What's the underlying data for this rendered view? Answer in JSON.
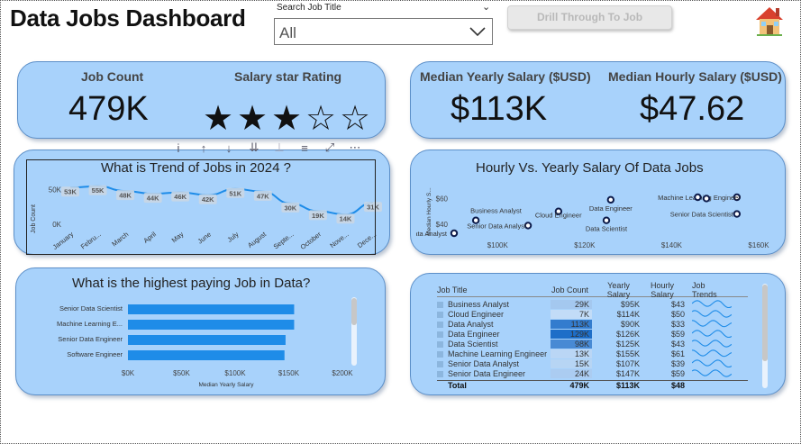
{
  "header": {
    "title": "Data Jobs Dashboard",
    "slicer_label": "Search Job Title",
    "slicer_value": "All",
    "drill_button": "Drill Through To Job"
  },
  "kpi_left": {
    "job_count_label": "Job Count",
    "job_count_value": "479K",
    "rating_label": "Salary star Rating",
    "rating_value": 3,
    "rating_max": 5
  },
  "kpi_right": {
    "median_yearly_label": "Median Yearly Salary ($USD)",
    "median_yearly_value": "$113K",
    "median_hourly_label": "Median Hourly Salary ($USD)",
    "median_hourly_value": "$47.62"
  },
  "toolbar_icons": [
    "info-icon",
    "arrow-up-icon",
    "arrow-down-icon",
    "double-arrow-down-icon",
    "pin-icon",
    "filter-icon",
    "focus-mode-icon",
    "more-options-icon"
  ],
  "chart_data": [
    {
      "type": "line",
      "title": "What is Trend of Jobs in 2024 ?",
      "ylabel": "Job Count",
      "xlabel": "",
      "y_ticks": [
        "50K",
        "0K"
      ],
      "ylim": [
        0,
        65000
      ],
      "categories": [
        "January",
        "Febru...",
        "March",
        "April",
        "May",
        "June",
        "July",
        "August",
        "Septe...",
        "October",
        "Nove...",
        "Dece..."
      ],
      "values": [
        53000,
        55000,
        48000,
        44000,
        46000,
        42000,
        51000,
        47000,
        30000,
        19000,
        14000,
        31000
      ],
      "data_labels": [
        "53K",
        "55K",
        "48K",
        "44K",
        "46K",
        "42K",
        "51K",
        "47K",
        "30K",
        "19K",
        "14K",
        "31K"
      ],
      "grid": false,
      "color": "#1e8ce8"
    },
    {
      "type": "scatter",
      "title": "Hourly Vs. Yearly Salary Of Data Jobs",
      "ylabel": "Median Hourly S...",
      "xlabel": "",
      "x_ticks": [
        "$100K",
        "$120K",
        "$140K",
        "$160K"
      ],
      "y_ticks": [
        "$60",
        "$40"
      ],
      "xlim": [
        90000,
        160000
      ],
      "ylim": [
        30000,
        70000
      ],
      "points": [
        {
          "label": "Business Analyst",
          "x": 95000,
          "y": 43
        },
        {
          "label": "Data Analyst",
          "x": 90000,
          "y": 33
        },
        {
          "label": "Cloud Engineer",
          "x": 114000,
          "y": 50
        },
        {
          "label": "Data Engineer",
          "x": 126000,
          "y": 59
        },
        {
          "label": "Data Scientist",
          "x": 125000,
          "y": 43
        },
        {
          "label": "Machine Learning Engineer",
          "x": 155000,
          "y": 61
        },
        {
          "label": "Senior Data Analyst",
          "x": 107000,
          "y": 39
        },
        {
          "label": "Senior Data Scientist",
          "x": 155000,
          "y": 48
        },
        {
          "label": "",
          "x": 148000,
          "y": 60
        },
        {
          "label": "",
          "x": 146000,
          "y": 61
        }
      ],
      "color": "#0d1b4a"
    },
    {
      "type": "bar",
      "orientation": "horizontal",
      "title": "What is the highest paying Job in Data?",
      "xlabel": "Median Yearly Salary",
      "ylabel": "",
      "categories": [
        "Senior Data Scientist",
        "Machine Learning E...",
        "Senior Data Engineer",
        "Software Engineer"
      ],
      "values": [
        155000,
        155000,
        147000,
        146000
      ],
      "x_ticks": [
        "$0K",
        "$50K",
        "$100K",
        "$150K",
        "$200K"
      ],
      "xlim": [
        0,
        200000
      ],
      "color": "#1e8ce8"
    },
    {
      "type": "table",
      "columns": [
        "Job Title",
        "Job Count",
        "Yearly Salary",
        "Hourly Salary",
        "Job Trends"
      ],
      "rows": [
        {
          "title": "Business Analyst",
          "count": "29K",
          "count_num": 29,
          "yearly": "$95K",
          "hourly": "$43"
        },
        {
          "title": "Cloud Engineer",
          "count": "7K",
          "count_num": 7,
          "yearly": "$114K",
          "hourly": "$50"
        },
        {
          "title": "Data Analyst",
          "count": "113K",
          "count_num": 113,
          "yearly": "$90K",
          "hourly": "$33"
        },
        {
          "title": "Data Engineer",
          "count": "129K",
          "count_num": 129,
          "yearly": "$126K",
          "hourly": "$59"
        },
        {
          "title": "Data Scientist",
          "count": "98K",
          "count_num": 98,
          "yearly": "$125K",
          "hourly": "$43"
        },
        {
          "title": "Machine Learning Engineer",
          "count": "13K",
          "count_num": 13,
          "yearly": "$155K",
          "hourly": "$61"
        },
        {
          "title": "Senior Data Analyst",
          "count": "15K",
          "count_num": 15,
          "yearly": "$107K",
          "hourly": "$39"
        },
        {
          "title": "Senior Data Engineer",
          "count": "24K",
          "count_num": 24,
          "yearly": "$147K",
          "hourly": "$59"
        }
      ],
      "total": {
        "title": "Total",
        "count": "479K",
        "yearly": "$113K",
        "hourly": "$48"
      }
    }
  ]
}
